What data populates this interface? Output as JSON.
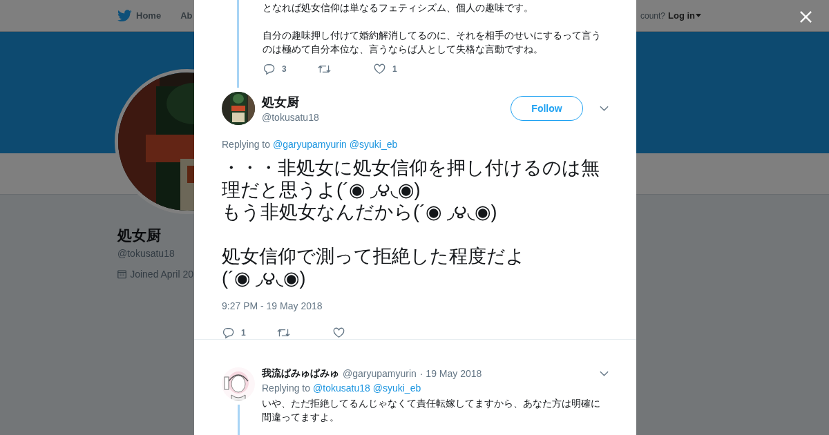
{
  "page": {
    "nav": [
      {
        "label": "Home",
        "kind": "brand"
      },
      {
        "label": "Ab",
        "kind": "link"
      }
    ],
    "login_prompt": "count?",
    "login": "Log in",
    "profile": {
      "name": "処女厨",
      "handle": "@tokusatu18",
      "joined": "Joined April 20"
    }
  },
  "modal": {
    "previous_tweet": {
      "paragraphs": [
        "となれば処女信仰は単なるフェティシズム、個人の趣味です。",
        "自分の趣味押し付けて婚約解消してるのに、それを相手のせいにするって言うのは極めて自分本位な、言うならば人として失格な言動ですね。"
      ],
      "reply_count": "3",
      "like_count": "1"
    },
    "main_tweet": {
      "name": "処女厨",
      "handle": "@tokusatu18",
      "follow": "Follow",
      "replying_label": "Replying to",
      "mentions": [
        "@garyupamyurin",
        "@syuki_eb"
      ],
      "paragraphs": [
        [
          "・・・非処女に処女信仰を押し付けるのは無理だと思うよ(´◉ ◞౪◟◉)",
          "もう非処女なんだから(´◉ ◞౪◟◉)"
        ],
        [
          "処女信仰で測って拒絶した程度だよ",
          "(´◉ ◞౪◟◉)"
        ]
      ],
      "time": "9:27 PM - 19 May 2018",
      "reply_count": "1"
    },
    "reply_tweet": {
      "name": "我流ぱみゅぱみゅ",
      "handle": "@garyupamyurin",
      "date": "· 19 May 2018",
      "replying_label": "Replying to",
      "mentions": [
        "@tokusatu18",
        "@syuki_eb"
      ],
      "text": "いや、ただ拒絶してるんじゃなくて責任転嫁してますから、あなた方は明確に間違ってますよ。"
    }
  }
}
